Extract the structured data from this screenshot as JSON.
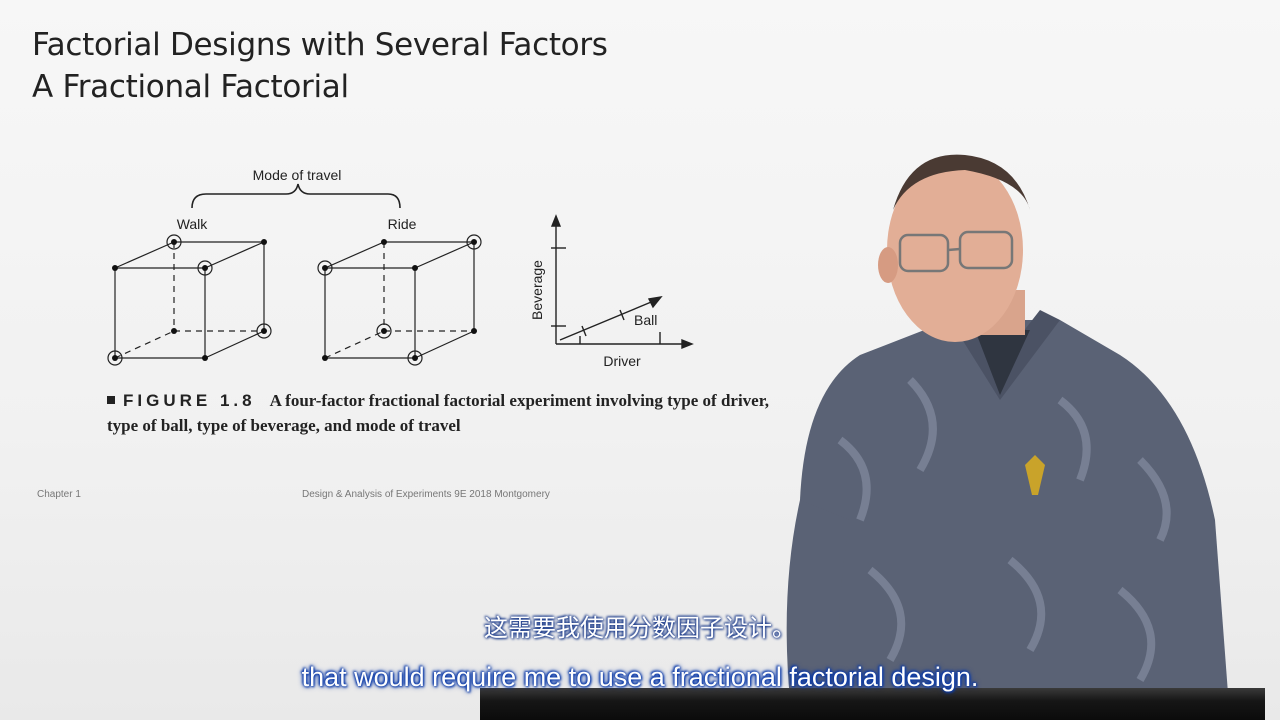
{
  "slide": {
    "title_line1": "Factorial Designs with Several Factors",
    "title_line2": "A Fractional Factorial"
  },
  "figure": {
    "brace_label": "Mode of travel",
    "cube_left_label": "Walk",
    "cube_right_label": "Ride",
    "axis_y_label": "Beverage",
    "axis_x_label": "Driver",
    "line_label": "Ball",
    "caption_number": "FIGURE 1.8",
    "caption_text": "A four-factor fractional factorial experiment involving type of driver, type of ball, type of beverage, and mode of travel"
  },
  "footer": {
    "left": "Chapter 1",
    "center": "Design & Analysis of Experiments 9E 2018 Montgomery"
  },
  "subtitles": {
    "chinese": "这需要我使用分数因子设计。",
    "english": "that would require me to use a fractional factorial design."
  },
  "colors": {
    "slide_background": "#f4f4f4",
    "subtitle_outline": "#0b3aa8",
    "shirt": "#5a6275"
  }
}
